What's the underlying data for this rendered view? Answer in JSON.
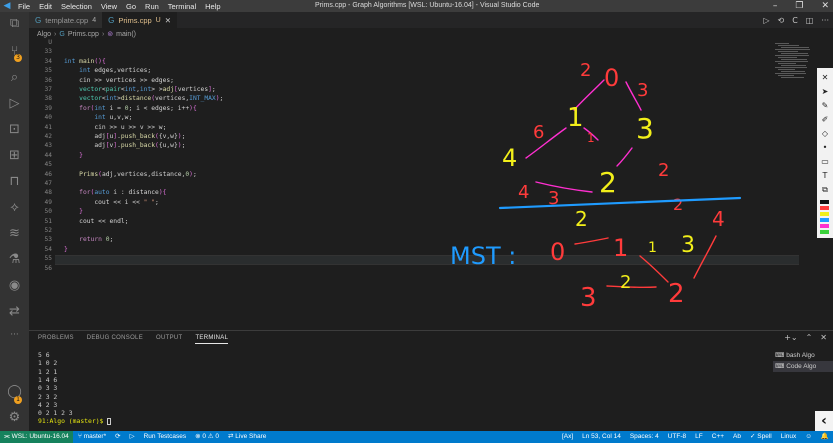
{
  "titlebar": {
    "menu": [
      "File",
      "Edit",
      "Selection",
      "View",
      "Go",
      "Run",
      "Terminal",
      "Help"
    ],
    "title": "Prims.cpp - Graph Algorithms [WSL: Ubuntu-16.04] - Visual Studio Code",
    "controls": [
      "–",
      "❐",
      "✕"
    ]
  },
  "tabs": [
    {
      "label": "template.cpp",
      "mark": "4",
      "active": false
    },
    {
      "label": "Prims.cpp",
      "mark": "U",
      "active": true
    }
  ],
  "breadcrumb": [
    "Algo",
    "Prims.cpp",
    "main()"
  ],
  "editor": {
    "lines": [
      {
        "n": "U",
        "html": ""
      },
      {
        "n": "33",
        "html": ""
      },
      {
        "n": "34",
        "html": "<span class='kw'>int</span> <span class='fn'>main</span><span class='pu'>()</span><span class='pu'>{</span>"
      },
      {
        "n": "35",
        "html": "    <span class='kw'>int</span> edges,vertices;"
      },
      {
        "n": "36",
        "html": "    cin &gt;&gt; vertices &gt;&gt; edges;"
      },
      {
        "n": "37",
        "html": "    <span class='ty'>vector</span>&lt;<span class='ty'>pair</span>&lt;<span class='kw'>int</span>,<span class='kw'>int</span>&gt; &gt;<span class='fn'>adj</span><span class='pu'>[</span>vertices<span class='pu'>]</span>;"
      },
      {
        "n": "38",
        "html": "    <span class='ty'>vector</span>&lt;<span class='kw'>int</span>&gt;<span class='fn'>distance</span><span class='pu'>(</span>vertices,<span class='kw'>INT_MAX</span><span class='pu'>)</span>;"
      },
      {
        "n": "39",
        "html": "    <span class='ctl'>for</span><span class='pu'>(</span><span class='kw'>int</span> i = <span class='nm'>0</span>; i &lt; edges; i++<span class='pu'>)</span><span class='pu'>{</span>"
      },
      {
        "n": "40",
        "html": "        <span class='kw'>int</span> u,v,w;"
      },
      {
        "n": "41",
        "html": "        cin &gt;&gt; u &gt;&gt; v &gt;&gt; w;"
      },
      {
        "n": "42",
        "html": "        adj<span class='pu'>[</span>u<span class='pu'>]</span>.<span class='fn'>push_back</span><span class='pu'>(</span>{v,w}<span class='pu'>)</span>;"
      },
      {
        "n": "43",
        "html": "        adj<span class='pu'>[</span>v<span class='pu'>]</span>.<span class='fn'>push_back</span><span class='pu'>(</span>{u,w}<span class='pu'>)</span>;"
      },
      {
        "n": "44",
        "html": "    <span class='pu'>}</span>"
      },
      {
        "n": "45",
        "html": ""
      },
      {
        "n": "46",
        "html": "    <span class='fn'>Prims</span><span class='pu'>(</span>adj,vertices,distance,<span class='nm'>0</span><span class='pu'>)</span>;"
      },
      {
        "n": "47",
        "html": ""
      },
      {
        "n": "48",
        "html": "    <span class='ctl'>for</span><span class='pu'>(</span><span class='kw'>auto</span> i : distance<span class='pu'>)</span><span class='pu'>{</span>"
      },
      {
        "n": "49",
        "html": "        cout &lt;&lt; i &lt;&lt; <span class='st'>\" \"</span>;"
      },
      {
        "n": "50",
        "html": "    <span class='pu'>}</span>"
      },
      {
        "n": "51",
        "html": "    cout &lt;&lt; endl;"
      },
      {
        "n": "52",
        "html": ""
      },
      {
        "n": "53",
        "html": "    <span class='ctl'>return</span> <span class='nm'>0</span>;"
      },
      {
        "n": "54",
        "html": "<span class='pu'>}</span>"
      },
      {
        "n": "55",
        "html": ""
      },
      {
        "n": "56",
        "html": ""
      }
    ]
  },
  "annotations": {
    "graph_labels": [
      "0",
      "1",
      "2",
      "3",
      "4",
      "2",
      "6",
      "3",
      "4",
      "1",
      "2",
      "3",
      "2"
    ],
    "mst_label": "MST :",
    "mst_labels": [
      "0",
      "1",
      "3",
      "2",
      "3",
      "2",
      "1",
      "2",
      "4"
    ],
    "colors": {
      "red": "#ff3b3b",
      "magenta": "#ff2fd0",
      "yellow": "#f2ef1a",
      "blue": "#1f9bff"
    }
  },
  "panel": {
    "tabs": [
      "PROBLEMS",
      "DEBUG CONSOLE",
      "OUTPUT",
      "TERMINAL"
    ],
    "active_tab": "TERMINAL",
    "terminal_lines": [
      "5 6",
      "1 0 2",
      "1 2 1",
      "1 4 6",
      "0 3 3",
      "2 3 2",
      "4 2 3",
      "0 2 1 2 3"
    ],
    "prompt_path": "91:Algo",
    "prompt_branch": "(master)$",
    "terminal_list": [
      "bash Algo",
      "Code Algo"
    ]
  },
  "statusbar": {
    "remote": "WSL: Ubuntu-16.04",
    "branch": "master*",
    "sync": "⟳",
    "run": "▷",
    "testcases": "Run Testcases",
    "problems": "⊗ 0 ⚠ 0",
    "liveshare": "Live Share",
    "right": [
      "[Ax]",
      "Ln 53, Col 14",
      "Spaces: 4",
      "UTF-8",
      "LF",
      "C++",
      "Ab",
      "✓ Spell",
      "Linux",
      "☺",
      "🔔"
    ]
  }
}
